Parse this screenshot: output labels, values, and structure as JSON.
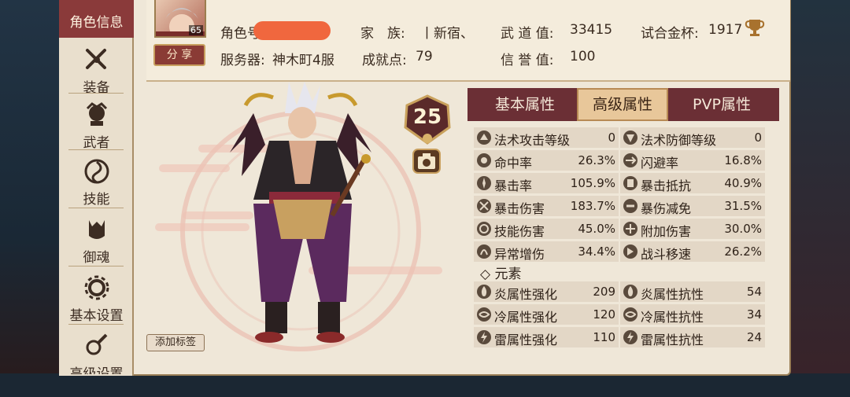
{
  "sidebar": {
    "items": [
      {
        "label": "角色信息",
        "icon": "character-icon"
      },
      {
        "label": "装备",
        "icon": "equipment-icon"
      },
      {
        "label": "武者",
        "icon": "warrior-icon"
      },
      {
        "label": "技能",
        "icon": "skill-icon"
      },
      {
        "label": "御魂",
        "icon": "soul-icon"
      },
      {
        "label": "基本设置",
        "icon": "gear-icon"
      },
      {
        "label": "高级设置",
        "icon": "advanced-settings-icon"
      }
    ]
  },
  "header": {
    "avatar_level": "65",
    "share_label": "分 享",
    "role_label": "角色号:",
    "family_label": "家　族:",
    "family_value": "丨新宿、",
    "wudao_label": "武 道 值:",
    "wudao_value": "33415",
    "cup_label": "试合金杯:",
    "cup_value": "1917",
    "server_label": "服务器:",
    "server_value": "神木町4服",
    "achieve_label": "成就点:",
    "achieve_value": "79",
    "credit_label": "信 誉 值:",
    "credit_value": "100"
  },
  "character": {
    "level": "25",
    "add_tag_label": "添加标签"
  },
  "attr_panel": {
    "tabs": [
      "基本属性",
      "高级属性",
      "PVP属性"
    ],
    "active_tab": "高级属性",
    "stats": [
      [
        {
          "name": "法术攻击等级",
          "value": "0"
        },
        {
          "name": "法术防御等级",
          "value": "0"
        }
      ],
      [
        {
          "name": "命中率",
          "value": "26.3%"
        },
        {
          "name": "闪避率",
          "value": "16.8%"
        }
      ],
      [
        {
          "name": "暴击率",
          "value": "105.9%"
        },
        {
          "name": "暴击抵抗",
          "value": "40.9%"
        }
      ],
      [
        {
          "name": "暴击伤害",
          "value": "183.7%"
        },
        {
          "name": "暴伤减免",
          "value": "31.5%"
        }
      ],
      [
        {
          "name": "技能伤害",
          "value": "45.0%"
        },
        {
          "name": "附加伤害",
          "value": "30.0%"
        }
      ],
      [
        {
          "name": "异常增伤",
          "value": "34.4%"
        },
        {
          "name": "战斗移速",
          "value": "26.2%"
        }
      ]
    ],
    "element_title": "◇ 元素",
    "element_stats": [
      [
        {
          "name": "炎属性强化",
          "value": "209"
        },
        {
          "name": "炎属性抗性",
          "value": "54"
        }
      ],
      [
        {
          "name": "冷属性强化",
          "value": "120"
        },
        {
          "name": "冷属性抗性",
          "value": "34"
        }
      ],
      [
        {
          "name": "雷属性强化",
          "value": "110"
        },
        {
          "name": "雷属性抗性",
          "value": "24"
        }
      ]
    ]
  },
  "colors": {
    "accent": "#8a3a3a",
    "panel_bg": "#efe7d8",
    "tab_bg": "#6b2f35",
    "tab_active": "#e8c79a"
  }
}
